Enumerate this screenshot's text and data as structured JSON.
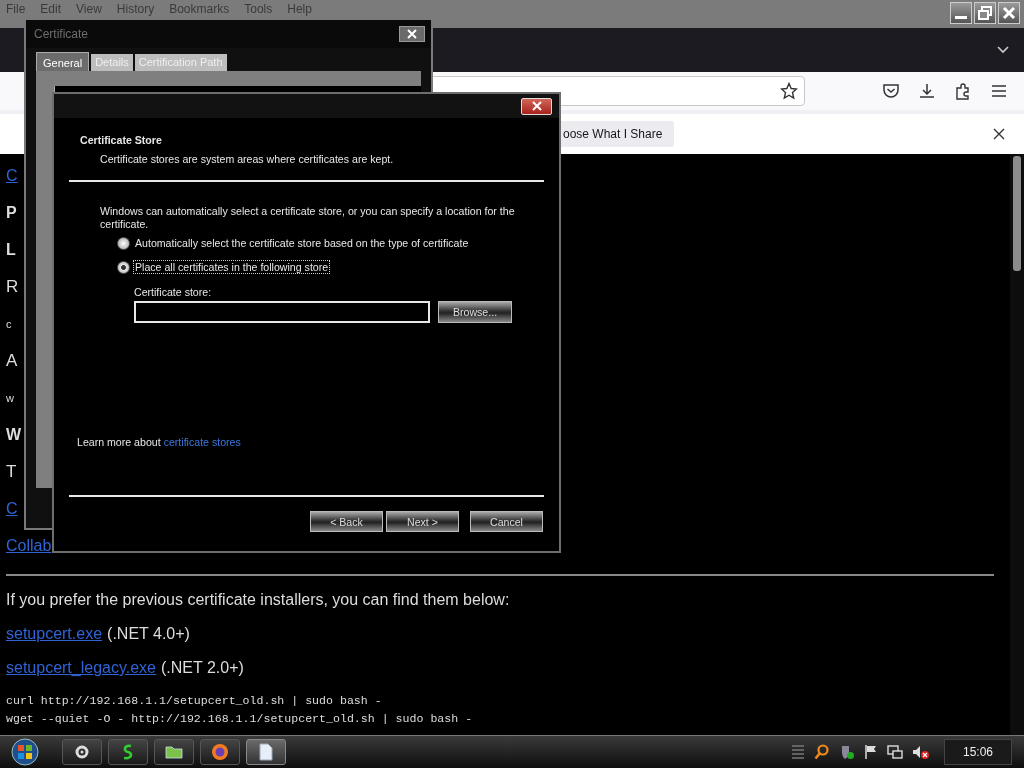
{
  "browser": {
    "menu": [
      "File",
      "Edit",
      "View",
      "History",
      "Bookmarks",
      "Tools",
      "Help"
    ],
    "notification": {
      "button": "oose What I Share"
    }
  },
  "page": {
    "cut_lines": [
      {
        "text": "C",
        "kind": "link"
      },
      {
        "text": "P",
        "kind": "heading"
      },
      {
        "text": "L",
        "kind": "heading"
      },
      {
        "text": "R",
        "kind": "text"
      },
      {
        "text": "c",
        "kind": "small"
      },
      {
        "text": "A",
        "kind": "text"
      },
      {
        "text": "w",
        "kind": "small"
      },
      {
        "text": "W",
        "kind": "heading"
      },
      {
        "text": "T",
        "kind": "text"
      },
      {
        "text": "C",
        "kind": "link"
      },
      {
        "text": "Collab",
        "kind": "link"
      }
    ],
    "paragraph": "If you prefer the previous certificate installers, you can find them below:",
    "downloads": [
      {
        "link": "setupcert.exe",
        "note": "(.NET 4.0+)"
      },
      {
        "link": "setupcert_legacy.exe",
        "note": "(.NET 2.0+)"
      }
    ],
    "code": [
      "curl http://192.168.1.1/setupcert_old.sh | sudo bash -",
      "wget --quiet -O - http://192.168.1.1/setupcert_old.sh | sudo bash -"
    ]
  },
  "certificate_window": {
    "title": "Certificate",
    "tabs": [
      {
        "label": "General",
        "selected": true
      },
      {
        "label": "Details",
        "selected": false
      },
      {
        "label": "Certification Path",
        "selected": false
      }
    ]
  },
  "wizard": {
    "heading": "Certificate Store",
    "subheading": "Certificate stores are system areas where certificates are kept.",
    "intro": "Windows can automatically select a certificate store, or you can specify a location for the certificate.",
    "options": [
      {
        "label": "Automatically select the certificate store based on the type of certificate",
        "selected": false
      },
      {
        "label": "Place all certificates in the following store",
        "selected": true
      }
    ],
    "store_label": "Certificate store:",
    "browse": "Browse...",
    "learn_more": "Learn more about",
    "learn_link": "certificate stores",
    "buttons": [
      "< Back",
      "Next >",
      "Cancel"
    ]
  },
  "taskbar": {
    "clock": "15:06"
  }
}
